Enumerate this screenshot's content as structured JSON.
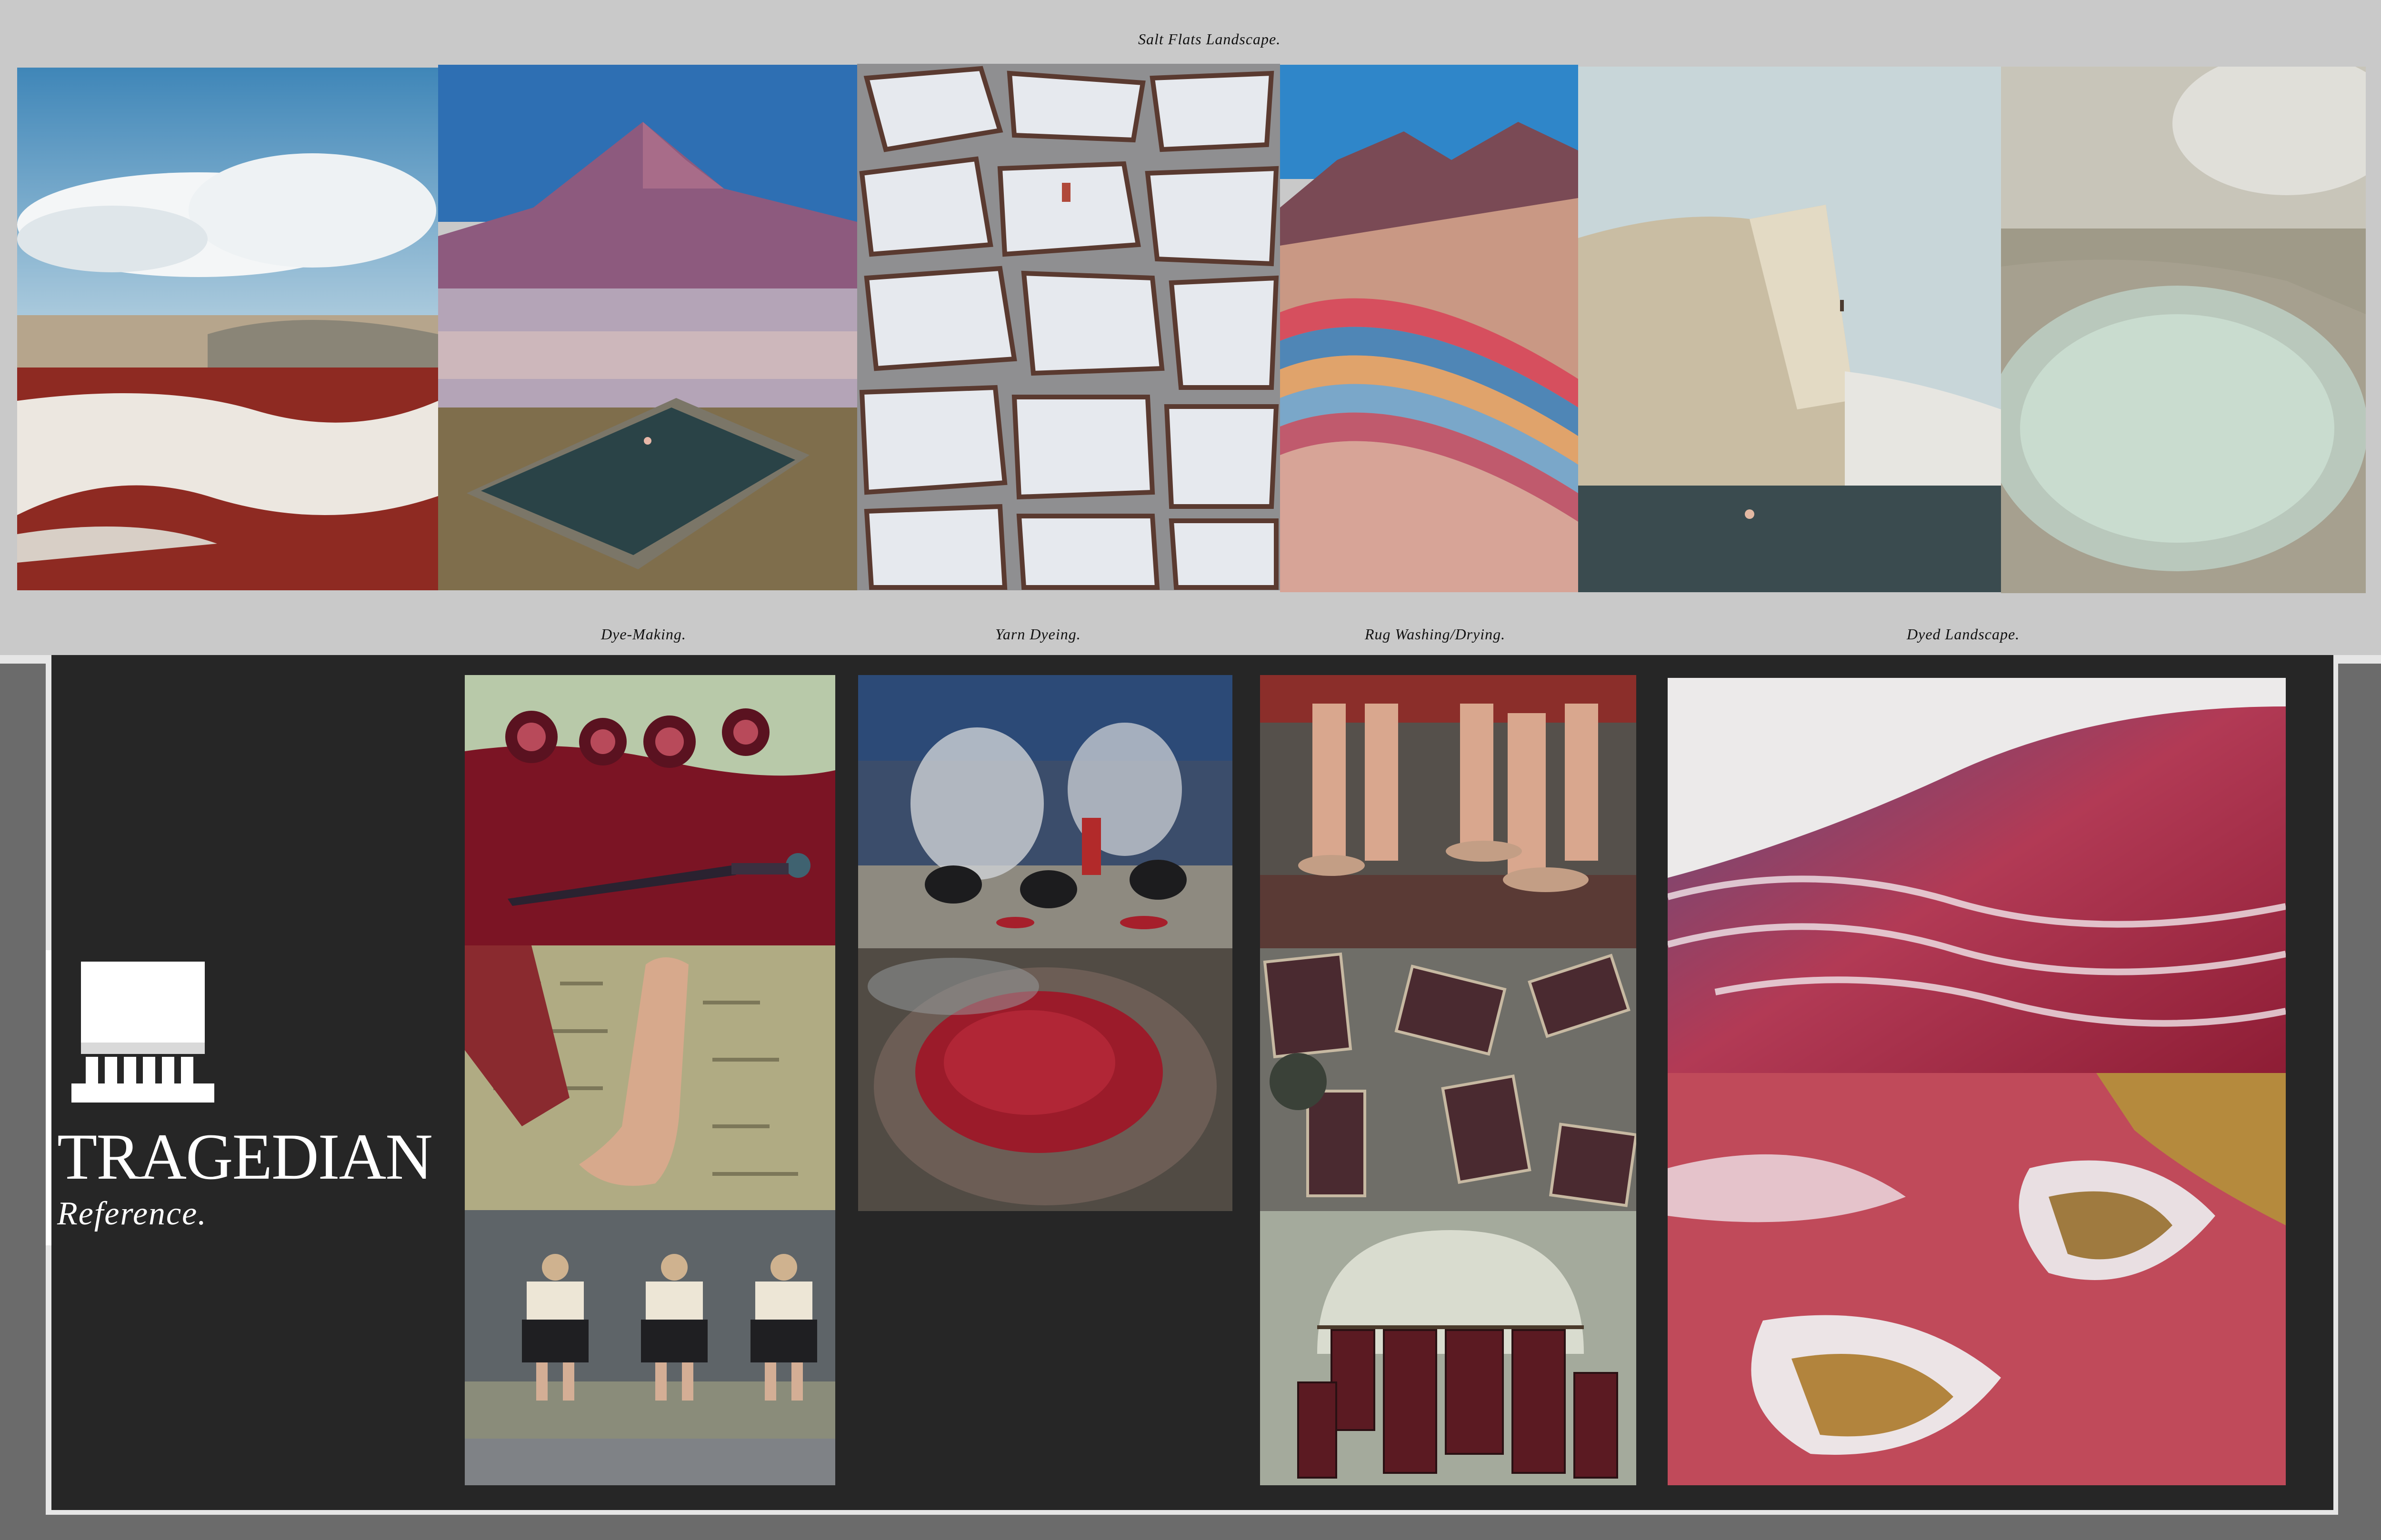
{
  "sections": {
    "salt_flats": "Salt Flats Landscape.",
    "dye_making": "Dye-Making.",
    "yarn_dyeing": "Yarn Dyeing.",
    "rug_washing": "Rug Washing/Drying.",
    "dyed_landscape": "Dyed Landscape."
  },
  "brand": {
    "name": "TRAGEDIAN",
    "subtitle": "Reference.",
    "logo_icon": "columned-pedestal-logo"
  },
  "colors": {
    "top_band": "#c9c9c9",
    "dark_panel": "#262626",
    "frame": "#e6e6e6",
    "accent_red": "#9b1b2a"
  }
}
